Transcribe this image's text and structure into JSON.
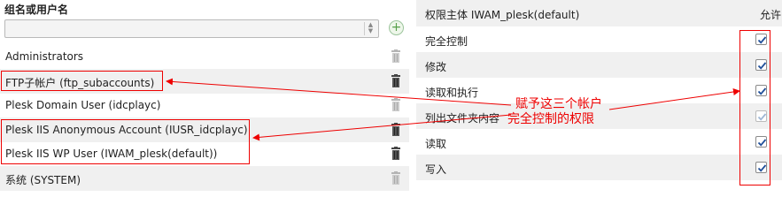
{
  "left": {
    "header": "组名或用户名",
    "rows": [
      {
        "label": "Administrators"
      },
      {
        "label": "FTP子帐户 (ftp_subaccounts)"
      },
      {
        "label": "Plesk Domain User (idcplayc)"
      },
      {
        "label": "Plesk IIS Anonymous Account (IUSR_idcplayc)"
      },
      {
        "label": "Plesk IIS WP User (IWAM_plesk(default))"
      },
      {
        "label": "系统 (SYSTEM)"
      }
    ]
  },
  "right": {
    "header_principal": "权限主体 IWAM_plesk(default)",
    "header_allow": "允许",
    "permissions": [
      {
        "label": "完全控制",
        "checked": true
      },
      {
        "label": "修改",
        "checked": true
      },
      {
        "label": "读取和执行",
        "checked": true
      },
      {
        "label": "列出文件夹内容",
        "checked": true
      },
      {
        "label": "读取",
        "checked": true
      },
      {
        "label": "写入",
        "checked": true
      }
    ]
  },
  "annotation": {
    "line1": "赋予这三个帐户",
    "line2": "完全控制的权限"
  },
  "colors": {
    "annotation": "#e00000",
    "check": "#1f4f9a",
    "stripe": "#f0f0f0"
  }
}
